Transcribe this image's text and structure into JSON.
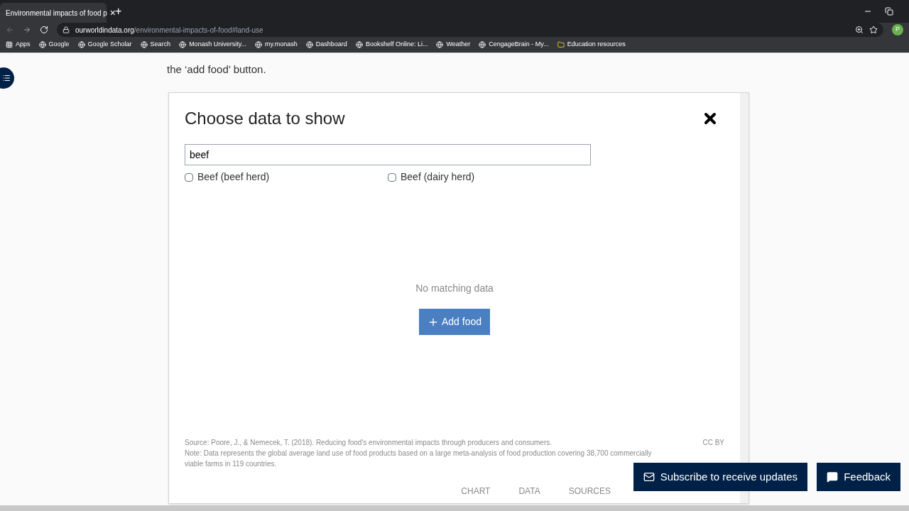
{
  "browser": {
    "tab": {
      "title": "Environmental impacts of food p",
      "close": "×"
    },
    "new_tab": "+",
    "url_host": "ourworldindata.org",
    "url_path": "/environmental-impacts-of-food#land-use",
    "profile": "P",
    "bookmarks": [
      {
        "label": "Apps"
      },
      {
        "label": "Google"
      },
      {
        "label": "Google Scholar"
      },
      {
        "label": "Search"
      },
      {
        "label": "Monash University..."
      },
      {
        "label": "my.monash"
      },
      {
        "label": "Dashboard"
      },
      {
        "label": "Bookshelf Online: Li..."
      },
      {
        "label": "Weather"
      },
      {
        "label": "CengageBrain - My..."
      },
      {
        "label": "Education resources"
      }
    ]
  },
  "article": {
    "text": "the ‘add food’ button."
  },
  "modal": {
    "title": "Choose data to show",
    "search": {
      "value": "beef"
    },
    "options": [
      {
        "label": "Beef (beef herd)",
        "checked": false
      },
      {
        "label": "Beef (dairy herd)",
        "checked": false
      }
    ],
    "background": {
      "empty": "No matching data",
      "add_button": "Add food",
      "source": "Source: Poore, J., & Nemecek, T. (2018). Reducing food's environmental impacts through producers and consumers.",
      "license": "CC BY",
      "note": "Note: Data represents the global average land use of food products based on a large meta-analysis of food production covering 38,700 commercially viable farms in 119 countries.",
      "tabs": [
        {
          "label": "CHART",
          "selected": false
        },
        {
          "label": "DATA",
          "selected": false
        },
        {
          "label": "SOURCES",
          "selected": false
        }
      ]
    }
  },
  "subscribe_button": "Subscribe to receive updates",
  "feedback_button": "Feedback"
}
